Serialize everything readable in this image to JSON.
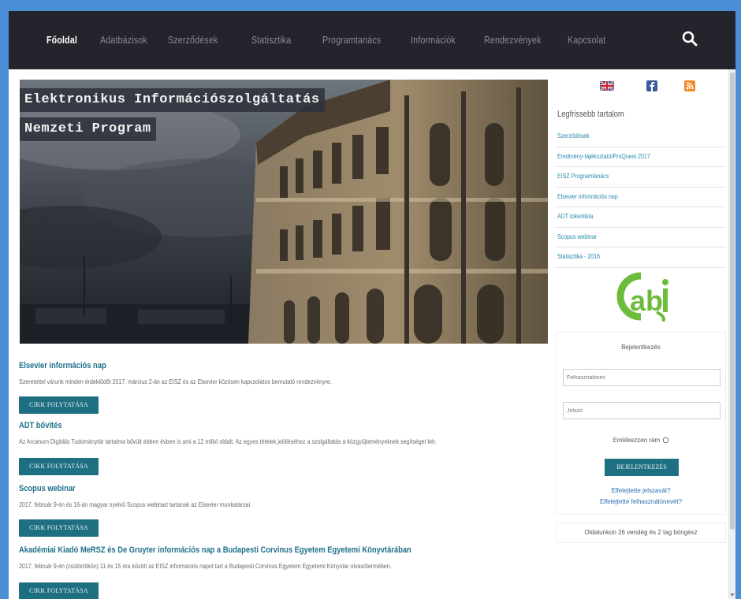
{
  "nav": {
    "items": [
      {
        "label": "Főoldal",
        "active": true
      },
      {
        "label": "Adatbázisok",
        "active": false
      },
      {
        "label": "Szerződések",
        "active": false
      },
      {
        "label": "Statisztika",
        "active": false
      },
      {
        "label": "Programtanács",
        "active": false
      },
      {
        "label": "Információk",
        "active": false
      },
      {
        "label": "Rendezvények",
        "active": false
      },
      {
        "label": "Kapcsolat",
        "active": false
      }
    ],
    "search_icon": "search-icon"
  },
  "hero": {
    "title_line1": "Elektronikus Információszolgáltatás",
    "title_line2": "Nemzeti Program"
  },
  "articles": [
    {
      "title": "Elsevier információs nap",
      "text": "Szeretettel várunk minden érdeklődőt 2017. március 2-án az EISZ és az Elsevier közösen kapcsolatos bemutató rendezvényre.",
      "button": "CIKK FOLYTATÁSA"
    },
    {
      "title": "ADT bővítés",
      "text": "Az Arcanum Digitális Tudománytár tartalma bővült ebben évben is ami a 12 millió oldalt. Az egyes tételek jelöléséhez a szolgáltatás a közgyűjteményeknek segítséget kér.",
      "button": "CIKK FOLYTATÁSA"
    },
    {
      "title": "Scopus webinar",
      "text": "2017. február 9-én és 16-án magyar nyelvű Scopus webinart tartanak az Elsevier munkatársai.",
      "button": "CIKK FOLYTATÁSA"
    },
    {
      "title": "Akadémiai Kiadó MeRSZ és De Gruyter információs nap a Budapesti Corvinus Egyetem Egyetemi Könyvtárában",
      "text": "2017. február 9-én (csütörtökön) 11 és 15 óra között az EISZ információs napot tart a Budapesti Corvinus Egyetem Egyetemi Könyvtár olvasótermében.",
      "button": "CIKK FOLYTATÁSA"
    }
  ],
  "sidebar": {
    "social": [
      "flag-uk-icon",
      "facebook-icon",
      "rss-icon"
    ],
    "popular_title": "Legfrissebb tartalom",
    "popular_items": [
      "Szerződések",
      "Eredmény-tájékoztató/ProQuest 2017",
      "EISZ Programtanács",
      "Elsevier információs nap",
      "ADT tokenlista",
      "Scopus webinar",
      "Statisztika - 2016"
    ],
    "logo": "cabi-logo"
  },
  "login": {
    "title": "Bejelentkezés",
    "username_placeholder": "Felhasználónév",
    "password_placeholder": "Jelszó",
    "remember_label": "Emlékezzen rám",
    "button": "BEJELENTKEZÉS",
    "forgot_password": "Elfelejtette jelszavát?",
    "forgot_username": "Elfelejtette felhasználónevét?"
  },
  "visitors_text": "Oldalunkon 26 vendég és 2 tag böngész"
}
